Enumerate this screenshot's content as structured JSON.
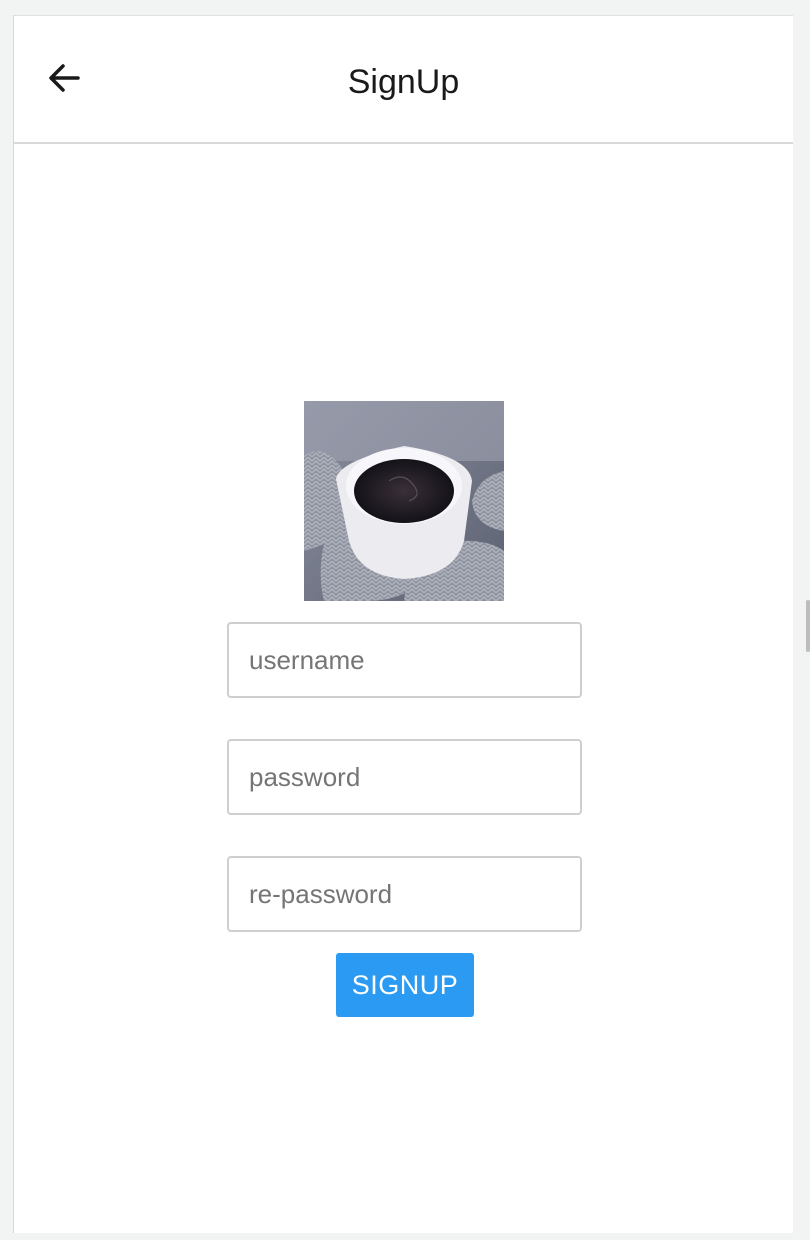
{
  "navbar": {
    "title": "SignUp",
    "back_icon": "arrow-left-icon"
  },
  "form": {
    "username_placeholder": "username",
    "password_placeholder": "password",
    "repassword_placeholder": "re-password",
    "signup_label": "SIGNUP"
  },
  "colors": {
    "button": "#2b9af3",
    "background": "#f2f3f3"
  }
}
